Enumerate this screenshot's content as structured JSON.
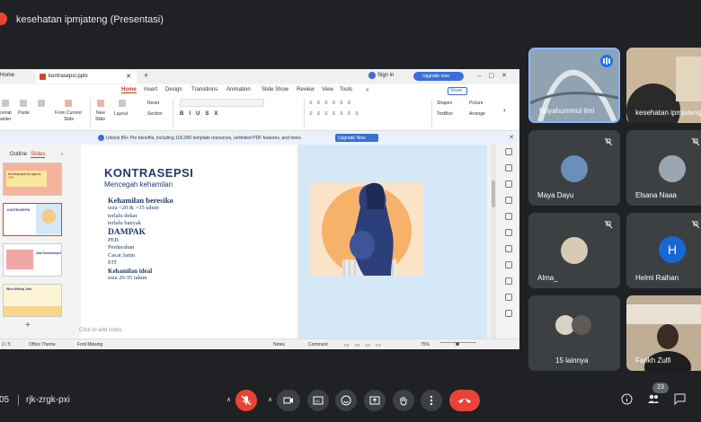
{
  "meeting": {
    "title": "kesehatan ipmjateng (Presentasi)",
    "time": "05",
    "code": "rjk-zrgk-pxi",
    "participants_count": "23"
  },
  "ppt": {
    "home_tab": "Home",
    "file_tab": "kontrasepsi.pptx",
    "sign_in": "Sign in",
    "upgrade_label": "Upgrade now",
    "menu": [
      "Home",
      "Insert",
      "Design",
      "Transitions",
      "Animation",
      "Slide Show",
      "Review",
      "View",
      "Tools"
    ],
    "share": "Share",
    "ribbon": {
      "painter": "ormat",
      "painter2": "ainter",
      "paste": "Paste",
      "from_current": "From Current",
      "from_current2": "Slide",
      "new_slide": "New",
      "new_slide2": "Slide",
      "layout": "Layout",
      "reset": "Reset",
      "section": "Section",
      "shapes": "Shapes",
      "picture": "Picture",
      "textbox": "TextBox",
      "arrange": "Arrange"
    },
    "notice": "Unlock 80+ Pro benefits, including 100,000 template resources, unlimited PDF features, and more.",
    "notice_button": "Upgrade Now",
    "pane_tabs": [
      "Outline",
      "Slides"
    ],
    "thumbs": [
      {
        "num": "1",
        "text": "Kontrasepsi itu apa si ???"
      },
      {
        "num": "2",
        "text": "KONTRASEPSI"
      },
      {
        "num": "3",
        "text": "Alat Kontrasepsi"
      },
      {
        "num": "4",
        "text": "Who Wallop Jaro"
      }
    ],
    "slide": {
      "title": "KONTRASEPSI",
      "subtitle": "Mencegah kehamilan",
      "h1": "Kehamilan beresiko",
      "l1": "usia <20 & >35 tahun",
      "l2": "terlalu dekat",
      "l3": "terlalu banyak",
      "h2": "DAMPAK",
      "d1": "PEB",
      "d2": "Perdarahan",
      "d3": "Cacat Janin",
      "d4": "PJT",
      "h3": "Kehamilan ideal",
      "l4": "usia 20-35 tahun"
    },
    "notes": "Click to add notes",
    "status": {
      "slide_num": "2 / 5",
      "theme": "Office Theme",
      "font": "Font Missing",
      "notes": "Notes",
      "comment": "Comment",
      "zoom": "75%"
    }
  },
  "tiles": [
    {
      "name": "faliyahummul ilmi"
    },
    {
      "name": "kesehatan ipmjateng"
    },
    {
      "name": "Maya Dayu"
    },
    {
      "name": "Elsana Naaa"
    },
    {
      "name": "Alma_"
    },
    {
      "name": "Helmi Raihan",
      "initial": "H"
    },
    {
      "name": "15 lainnya"
    },
    {
      "name": "Farikh Zulfi"
    }
  ],
  "colors": {
    "accent_red": "#ea4335",
    "accent_blue": "#1a73e8",
    "ppt_accent": "#c43e1c",
    "slide_title": "#1f3a6e"
  }
}
